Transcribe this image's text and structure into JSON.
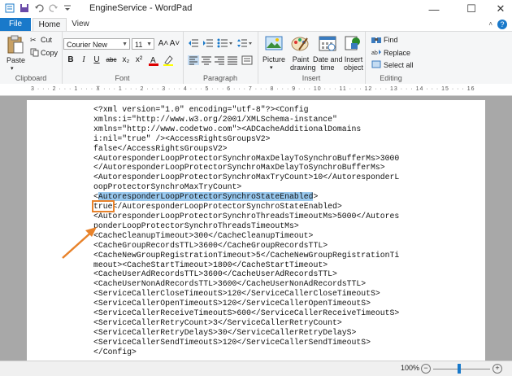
{
  "window": {
    "title": "EngineService - WordPad",
    "minimize": "—",
    "maximize": "☐",
    "close": "✕"
  },
  "tabs": {
    "file": "File",
    "home": "Home",
    "view": "View",
    "help": "?"
  },
  "ribbon": {
    "clipboard": {
      "label": "Clipboard",
      "paste": "Paste",
      "cut": "Cut",
      "copy": "Copy"
    },
    "font": {
      "label": "Font",
      "family": "Courier New",
      "size": "11",
      "bold": "B",
      "italic": "I",
      "underline": "U",
      "strike": "abc",
      "sub": "x₂",
      "sup": "x²",
      "grow": "A˄",
      "shrink": "A˅"
    },
    "paragraph": {
      "label": "Paragraph"
    },
    "insert": {
      "label": "Insert",
      "picture": "Picture",
      "paint": "Paint\ndrawing",
      "datetime": "Date and\ntime",
      "object": "Insert\nobject"
    },
    "editing": {
      "label": "Editing",
      "find": "Find",
      "replace": "Replace",
      "selectall": "Select all"
    }
  },
  "ruler": {
    "scale": "3 · · · 2 · · · 1 · · · ⊼ · · · 1 · · · 2 · · · 3 · · · 4 · · · 5 · · · 6 · · · 7 · · · 8 · · · 9 · · · 10 · · · 11 · · · 12 · · · 13 · · · 14 · · · 15 · · · 16 · · · 17 ·"
  },
  "document": {
    "lines_before": [
      "<?xml version=\"1.0\" encoding=\"utf-8\"?><Config",
      "xmlns:i=\"http://www.w3.org/2001/XMLSchema-instance\"",
      "xmlns=\"http://www.codetwo.com\"><ADCacheAdditionalDomains",
      "i:nil=\"true\" /><AccessRightsGroupsV2>",
      "false</AccessRightsGroupsV2>",
      "<AutoresponderLoopProtectorSynchroMaxDelayToSynchroBufferMs>3000",
      "</AutoresponderLoopProtectorSynchroMaxDelayToSynchroBufferMs>",
      "<AutoresponderLoopProtectorSynchroMaxTryCount>10</AutoresponderL",
      "oopProtectorSynchroMaxTryCount>"
    ],
    "hl_open": "<",
    "hl_text": "AutoresponderLoopProtectorSynchroStateEnabled",
    "hl_close": ">",
    "boxed_value": "true",
    "after_boxed": "</AutoresponderLoopProtectorSynchroStateEnabled>",
    "lines_after": [
      "<AutoresponderLoopProtectorSynchroThreadsTimeoutMs>5000</Autores",
      "ponderLoopProtectorSynchroThreadsTimeoutMs>",
      "<CacheCleanupTimeout>300</CacheCleanupTimeout>",
      "<CacheGroupRecordsTTL>3600</CacheGroupRecordsTTL>",
      "<CacheNewGroupRegistrationTimeout>5</CacheNewGroupRegistrationTi",
      "meout><CacheStartTimeout>1800</CacheStartTimeout>",
      "<CacheUserAdRecordsTTL>3600</CacheUserAdRecordsTTL>",
      "<CacheUserNonAdRecordsTTL>3600</CacheUserNonAdRecordsTTL>",
      "<ServiceCallerCloseTimeoutS>120</ServiceCallerCloseTimeoutS>",
      "<ServiceCallerOpenTimeoutS>120</ServiceCallerOpenTimeoutS>",
      "<ServiceCallerReceiveTimeoutS>600</ServiceCallerReceiveTimeoutS>",
      "<ServiceCallerRetryCount>3</ServiceCallerRetryCount>",
      "<ServiceCallerRetryDelayS>30</ServiceCallerRetryDelayS>",
      "<ServiceCallerSendTimeoutS>120</ServiceCallerSendTimeoutS>",
      "</Config>"
    ]
  },
  "status": {
    "zoom": "100%",
    "minus": "−",
    "plus": "+"
  },
  "colors": {
    "accent": "#1979ca",
    "highlight": "#99c9ef",
    "annotation": "#e8822a"
  }
}
